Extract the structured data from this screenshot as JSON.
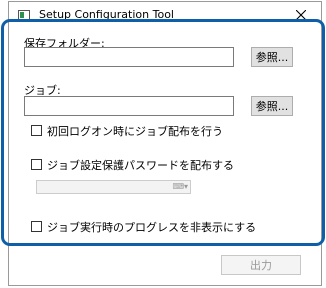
{
  "window": {
    "title": "Setup Configuration Tool",
    "accent_color": "#0f5fa8"
  },
  "form": {
    "save_folder_label": "保存フォルダー:",
    "save_folder_value": "",
    "browse_label": "参照...",
    "job_label": "ジョブ:",
    "job_value": "",
    "job_browse_label": "参照...",
    "initial_logon_label": "初回ログオン時にジョブ配布を行う",
    "initial_logon_checked": false,
    "distribute_password_label": "ジョブ設定保護パスワードを配布する",
    "distribute_password_checked": false,
    "password_value": "",
    "password_icon": "keyboard-icon",
    "hide_progress_label": "ジョブ実行時のプログレスを非表示にする",
    "hide_progress_checked": false
  },
  "footer": {
    "output_label": "出力"
  }
}
